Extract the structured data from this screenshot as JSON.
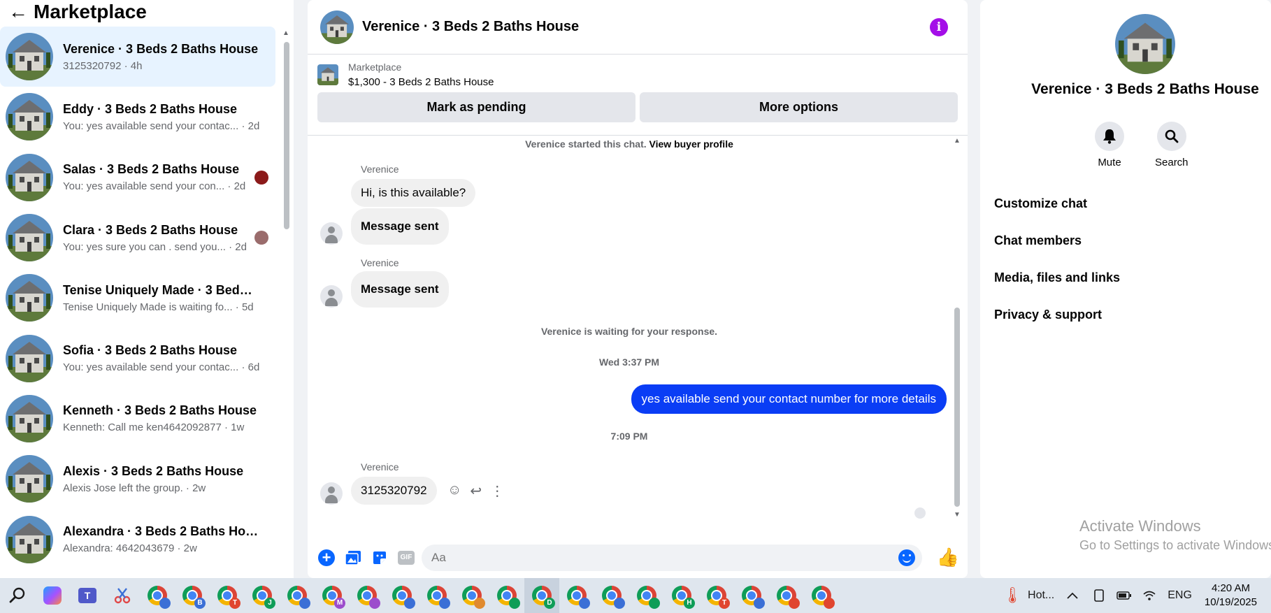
{
  "left": {
    "title": "Marketplace",
    "conversations": [
      {
        "name": "Verenice · 3 Beds 2 Baths House",
        "sub": "3125320792 · 4h"
      },
      {
        "name": "Eddy · 3 Beds 2 Baths House",
        "sub": "You: yes available send your contac... · 2d"
      },
      {
        "name": "Salas · 3 Beds 2 Baths House",
        "sub": "You: yes available send your con... · 2d"
      },
      {
        "name": "Clara · 3 Beds 2 Baths House",
        "sub": "You: yes sure you can . send you... · 2d"
      },
      {
        "name": "Tenise Uniquely Made · 3 Beds 2...",
        "sub": "Tenise Uniquely Made is waiting fo... · 5d"
      },
      {
        "name": "Sofia · 3 Beds 2 Baths House",
        "sub": "You: yes available send your contac... · 6d"
      },
      {
        "name": "Kenneth · 3 Beds 2 Baths House",
        "sub": "Kenneth: Call me ken4642092877 · 1w"
      },
      {
        "name": "Alexis · 3 Beds 2 Baths House",
        "sub": "Alexis Jose left the group. · 2w"
      },
      {
        "name": "Alexandra · 3 Beds 2 Baths House",
        "sub": "Alexandra: 4642043679 · 2w"
      }
    ]
  },
  "chat": {
    "title": "Verenice · 3 Beds 2 Baths House",
    "listing_source": "Marketplace",
    "listing_price": "$1,300 - 3 Beds 2 Baths House",
    "btn_pending": "Mark as pending",
    "btn_more": "More options",
    "started_text": "Verenice started this chat.",
    "started_link": "View buyer profile",
    "sender": "Verenice",
    "msg1": "Hi, is this available?",
    "msg2": "Message sent",
    "msg3": "Message sent",
    "waiting": "Verenice is waiting for your response.",
    "time1": "Wed 3:37 PM",
    "out_msg": "yes available send your contact number for more details",
    "time2": "7:09 PM",
    "msg4": "3125320792",
    "placeholder": "Aa"
  },
  "right": {
    "name": "Verenice · 3 Beds 2 Baths House",
    "mute": "Mute",
    "search": "Search",
    "menu": [
      "Customize chat",
      "Chat members",
      "Media, files and links",
      "Privacy & support"
    ]
  },
  "watermark": {
    "line1": "Activate Windows",
    "line2": "Go to Settings to activate Windows."
  },
  "taskbar": {
    "chrome_badges": [
      "",
      "B",
      "T",
      "J",
      "",
      "M",
      "",
      "",
      "",
      "",
      "",
      "D",
      "",
      "",
      "",
      "H",
      "T",
      "",
      "",
      ""
    ],
    "weather": "Hot...",
    "lang": "ENG",
    "time": "4:20 AM",
    "date": "10/19/2025"
  }
}
